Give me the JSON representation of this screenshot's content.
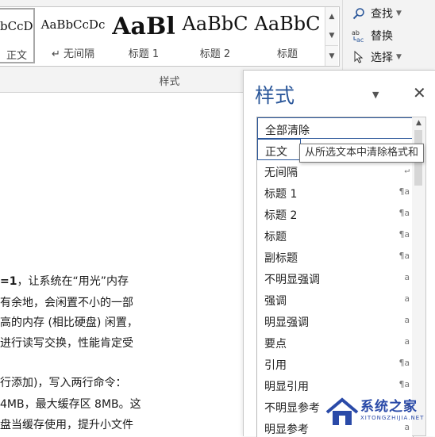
{
  "ribbon": {
    "styles": [
      {
        "preview": "bCcDc",
        "name": "正文",
        "selected": true
      },
      {
        "preview": "AaBbCcDc",
        "name": "↵ 无间隔",
        "selected": false
      },
      {
        "preview": "AaBl",
        "name": "标题 1",
        "selected": false
      },
      {
        "preview": "AaBbC",
        "name": "标题 2",
        "selected": false
      },
      {
        "preview": "AaBbC",
        "name": "标题",
        "selected": false
      }
    ],
    "group_label": "样式",
    "find_label": "查找",
    "replace_label": "替换",
    "select_label": "选择"
  },
  "document": {
    "lines": [
      {
        "bold": "=1",
        "text": "，让系统在“用光”内存"
      },
      {
        "text": "有余地，会闲置不小的一部"
      },
      {
        "text": "高的内存 (相比硬盘) 闲置，"
      },
      {
        "text": "进行读写交换，性能肯定受"
      },
      {
        "text": "行添加)，写入两行命令："
      },
      {
        "text": "4MB，最大缓存区 8MB。这"
      },
      {
        "text": "盘当缓存使用，提升小文件"
      }
    ]
  },
  "pane": {
    "title": "样式",
    "items": [
      {
        "label": "全部清除",
        "mark": ""
      },
      {
        "label": "正文",
        "mark": ""
      },
      {
        "label": "无间隔",
        "mark": "↵"
      },
      {
        "label": "标题 1",
        "mark": "¶a"
      },
      {
        "label": "标题 2",
        "mark": "¶a"
      },
      {
        "label": "标题",
        "mark": "¶a"
      },
      {
        "label": "副标题",
        "mark": "¶a"
      },
      {
        "label": "不明显强调",
        "mark": "a"
      },
      {
        "label": "强调",
        "mark": "a"
      },
      {
        "label": "明显强调",
        "mark": "a"
      },
      {
        "label": "要点",
        "mark": "a"
      },
      {
        "label": "引用",
        "mark": "¶a"
      },
      {
        "label": "明显引用",
        "mark": "¶a"
      },
      {
        "label": "不明显参考",
        "mark": "a"
      },
      {
        "label": "明显参考",
        "mark": "a"
      }
    ],
    "tooltip": "从所选文本中清除格式和"
  },
  "watermark": {
    "name": "系统之家",
    "url": "XITONGZHIJIA.NET"
  }
}
